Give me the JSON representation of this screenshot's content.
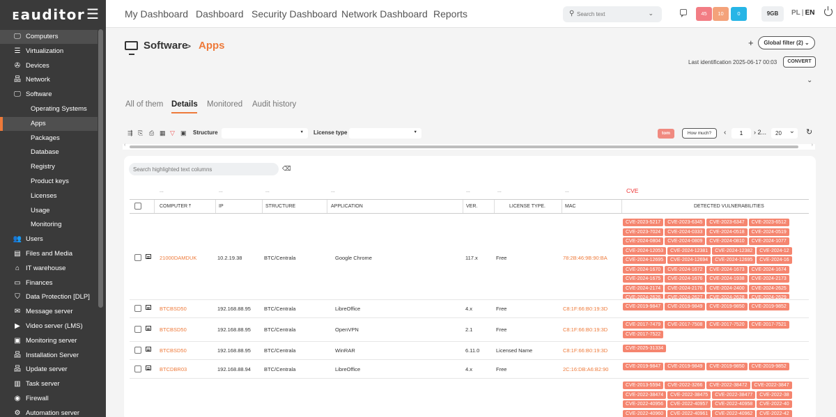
{
  "app": {
    "logo": "ᴇauditor"
  },
  "topnav": [
    "My Dashboard",
    "Dashboard",
    "Security Dashboard",
    "Network Dashboard",
    "Reports"
  ],
  "search": {
    "placeholder": "Search text"
  },
  "badges": [
    {
      "value": "45",
      "color": "#f27d84"
    },
    {
      "value": "10",
      "color": "#f4a27a"
    },
    {
      "value": "0",
      "color": "#27b5e6"
    }
  ],
  "storage": "9GB",
  "lang": {
    "pl": "PL",
    "en": "EN",
    "sep": "|"
  },
  "sidebar": [
    {
      "label": "Computers",
      "icon": "monitor-icon",
      "glyph": "🖵",
      "sub": false,
      "state": "active-parent"
    },
    {
      "label": "Virtualization",
      "icon": "servers-icon",
      "glyph": "☰",
      "sub": false,
      "state": ""
    },
    {
      "label": "Devices",
      "icon": "devices-icon",
      "glyph": "✇",
      "sub": false,
      "state": ""
    },
    {
      "label": "Network",
      "icon": "network-icon",
      "glyph": "品",
      "sub": false,
      "state": ""
    },
    {
      "label": "Software",
      "icon": "monitor-icon",
      "glyph": "🖵",
      "sub": false,
      "state": ""
    },
    {
      "label": "Operating Systems",
      "icon": "",
      "glyph": "",
      "sub": true,
      "state": ""
    },
    {
      "label": "Apps",
      "icon": "",
      "glyph": "",
      "sub": true,
      "state": "active"
    },
    {
      "label": "Packages",
      "icon": "",
      "glyph": "",
      "sub": true,
      "state": ""
    },
    {
      "label": "Database",
      "icon": "",
      "glyph": "",
      "sub": true,
      "state": ""
    },
    {
      "label": "Registry",
      "icon": "",
      "glyph": "",
      "sub": true,
      "state": ""
    },
    {
      "label": "Product keys",
      "icon": "",
      "glyph": "",
      "sub": true,
      "state": ""
    },
    {
      "label": "Licenses",
      "icon": "",
      "glyph": "",
      "sub": true,
      "state": ""
    },
    {
      "label": "Usage",
      "icon": "",
      "glyph": "",
      "sub": true,
      "state": ""
    },
    {
      "label": "Monitoring",
      "icon": "",
      "glyph": "",
      "sub": true,
      "state": ""
    },
    {
      "label": "Users",
      "icon": "users-icon",
      "glyph": "👥",
      "sub": false,
      "state": ""
    },
    {
      "label": "Files and Media",
      "icon": "file-icon",
      "glyph": "▤",
      "sub": false,
      "state": ""
    },
    {
      "label": "IT warehouse",
      "icon": "warehouse-icon",
      "glyph": "⌂",
      "sub": false,
      "state": ""
    },
    {
      "label": "Finances",
      "icon": "finances-icon",
      "glyph": "▭",
      "sub": false,
      "state": ""
    },
    {
      "label": "Data Protection [DLP]",
      "icon": "shield-icon",
      "glyph": "⛉",
      "sub": false,
      "state": ""
    },
    {
      "label": "Message server",
      "icon": "mail-icon",
      "glyph": "✉",
      "sub": false,
      "state": ""
    },
    {
      "label": "Video server (LMS)",
      "icon": "video-icon",
      "glyph": "▶",
      "sub": false,
      "state": ""
    },
    {
      "label": "Monitoring server",
      "icon": "monitoring-icon",
      "glyph": "▣",
      "sub": false,
      "state": ""
    },
    {
      "label": "Installation Server",
      "icon": "installation-icon",
      "glyph": "品",
      "sub": false,
      "state": ""
    },
    {
      "label": "Update server",
      "icon": "update-icon",
      "glyph": "品",
      "sub": false,
      "state": ""
    },
    {
      "label": "Task server",
      "icon": "task-icon",
      "glyph": "▥",
      "sub": false,
      "state": ""
    },
    {
      "label": "Firewall",
      "icon": "firewall-icon",
      "glyph": "◉",
      "sub": false,
      "state": ""
    },
    {
      "label": "Automation server",
      "icon": "automation-icon",
      "glyph": "⚙",
      "sub": false,
      "state": ""
    }
  ],
  "breadcrumb": {
    "section": "Software",
    "sep": ">",
    "page": "Apps"
  },
  "header": {
    "plus": "+",
    "global_filter": "Global filter (2) ⌄",
    "last_identification": "Last identification 2025-06-17 00:03",
    "convert": "CONVERT",
    "collapse": "⌄"
  },
  "tabs": [
    {
      "label": "All of them",
      "active": false
    },
    {
      "label": "Details",
      "active": true
    },
    {
      "label": "Monitored",
      "active": false
    },
    {
      "label": "Audit history",
      "active": false
    }
  ],
  "toolbar": {
    "structure_label": "Structure",
    "license_label": "License type",
    "tom": "tom",
    "how_much": "How much?",
    "page": "1",
    "prev": "‹",
    "next": "› 2...",
    "page_size": "20",
    "refresh": "↻"
  },
  "table": {
    "search_placeholder": "Search highlighted text columns",
    "dots": "...",
    "cve_filter": "CVE",
    "headers": [
      "COMPUTER ⤒",
      "IP",
      "STRUCTURE",
      "APPLICATION",
      "VER.",
      "LICENSE TYPE.",
      "MAC",
      "DETECTED VULNERABILITIES"
    ],
    "rows": [
      {
        "computer": "21000DAMDUK",
        "ip": "10.2.19.38",
        "structure": "BTC/Centrala",
        "application": "Google Chrome",
        "version": "117.x",
        "license": "Free",
        "mac": "78:2B:46:9B:90:BA",
        "cves": [
          "CVE-2023-5217",
          "CVE-2023-6345",
          "CVE-2023-6347",
          "CVE-2023-6512",
          "CVE-2023-7024",
          "CVE-2024-0333",
          "CVE-2024-0518",
          "CVE-2024-0519",
          "CVE-2024-0804",
          "CVE-2024-0809",
          "CVE-2024-0810",
          "CVE-2024-1077",
          "CVE-2024-12053",
          "CVE-2024-12381",
          "CVE-2024-12382",
          "CVE-2024-12",
          "CVE-2024-12695",
          "CVE-2024-12694",
          "CVE-2024-12695",
          "CVE-2024-16",
          "CVE-2024-1670",
          "CVE-2024-1672",
          "CVE-2024-1673",
          "CVE-2024-1674",
          "CVE-2024-1675",
          "CVE-2024-1676",
          "CVE-2024-1938",
          "CVE-2024-2173",
          "CVE-2024-2174",
          "CVE-2024-2176",
          "CVE-2024-2400",
          "CVE-2024-2625",
          "CVE-2024-2626",
          "CVE-2024-2627",
          "CVE-2024-2628",
          "CVE-2024-2629"
        ]
      },
      {
        "computer": "BTCBSD50",
        "ip": "192.168.88.95",
        "structure": "BTC/Centrala",
        "application": "LibreOffice",
        "version": "4.x",
        "license": "Free",
        "mac": "C8:1F:66:B0:19:3D",
        "cves": [
          "CVE-2019-9847",
          "CVE-2019-9849",
          "CVE-2019-9850",
          "CVE-2019-9852"
        ]
      },
      {
        "computer": "BTCBSD50",
        "ip": "192.168.88.95",
        "structure": "BTC/Centrala",
        "application": "OpenVPN",
        "version": "2.1",
        "license": "Free",
        "mac": "C8:1F:66:B0:19:3D",
        "cves": [
          "CVE-2017-7479",
          "CVE-2017-7508",
          "CVE-2017-7520",
          "CVE-2017-7521",
          "CVE-2017-7522"
        ]
      },
      {
        "computer": "BTCBSD50",
        "ip": "192.168.88.95",
        "structure": "BTC/Centrala",
        "application": "WinRAR",
        "version": "6.11.0",
        "license": "Licensed Name",
        "mac": "C8:1F:66:B0:19:3D",
        "cves": [
          "CVE-2025-31334"
        ]
      },
      {
        "computer": "BTCDBR03",
        "ip": "192.168.88.94",
        "structure": "BTC/Centrala",
        "application": "LibreOffice",
        "version": "4.x",
        "license": "Free",
        "mac": "2C:16:DB:A6:B2:90",
        "cves": [
          "CVE-2019-9847",
          "CVE-2019-9849",
          "CVE-2019-9850",
          "CVE-2019-9852"
        ]
      },
      {
        "computer": "",
        "ip": "",
        "structure": "",
        "application": "",
        "version": "",
        "license": "",
        "mac": "",
        "cves": [
          "CVE-2013-5594",
          "CVE-2022-3266",
          "CVE-2022-38472",
          "CVE-2022-3847",
          "CVE-2022-38474",
          "CVE-2022-38475",
          "CVE-2022-38477",
          "CVE-2022-38",
          "CVE-2022-40956",
          "CVE-2022-40957",
          "CVE-2022-40958",
          "CVE-2022-40",
          "CVE-2022-40960",
          "CVE-2022-40961",
          "CVE-2022-40962",
          "CVE-2022-42"
        ]
      }
    ]
  }
}
